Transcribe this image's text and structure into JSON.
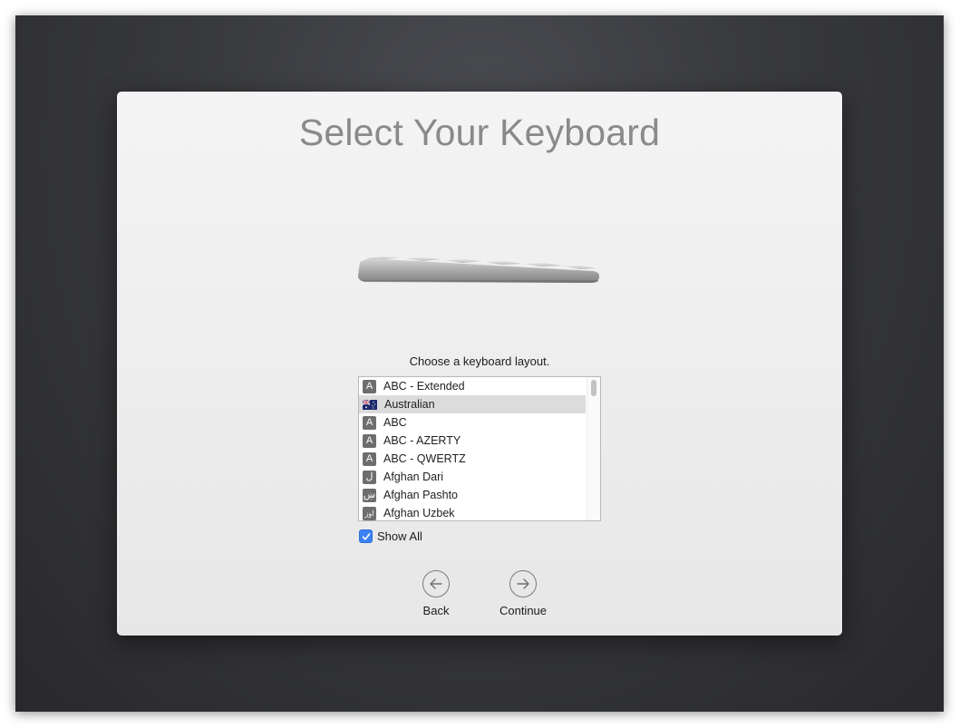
{
  "title": "Select Your Keyboard",
  "prompt": "Choose a keyboard layout.",
  "layouts": [
    {
      "label": "ABC - Extended",
      "icon": "A",
      "icon_name": "letter-a-icon",
      "selected": false
    },
    {
      "label": "Australian",
      "icon": "",
      "icon_name": "australia-flag-icon",
      "selected": true
    },
    {
      "label": "ABC",
      "icon": "A",
      "icon_name": "letter-a-icon",
      "selected": false
    },
    {
      "label": "ABC - AZERTY",
      "icon": "A",
      "icon_name": "letter-a-icon",
      "selected": false
    },
    {
      "label": "ABC - QWERTZ",
      "icon": "A",
      "icon_name": "letter-a-icon",
      "selected": false
    },
    {
      "label": "Afghan Dari",
      "icon": "ل",
      "icon_name": "dari-script-icon",
      "selected": false
    },
    {
      "label": "Afghan Pashto",
      "icon": "ښ",
      "icon_name": "pashto-script-icon",
      "selected": false
    },
    {
      "label": "Afghan Uzbek",
      "icon": "اوز",
      "icon_name": "uzbek-script-icon",
      "selected": false
    }
  ],
  "show_all": {
    "label": "Show All",
    "checked": true
  },
  "buttons": {
    "back": "Back",
    "continue": "Continue"
  },
  "colors": {
    "accent": "#3b82f6",
    "selected_row": "#dcdcdc",
    "title": "#8a8a8a"
  }
}
